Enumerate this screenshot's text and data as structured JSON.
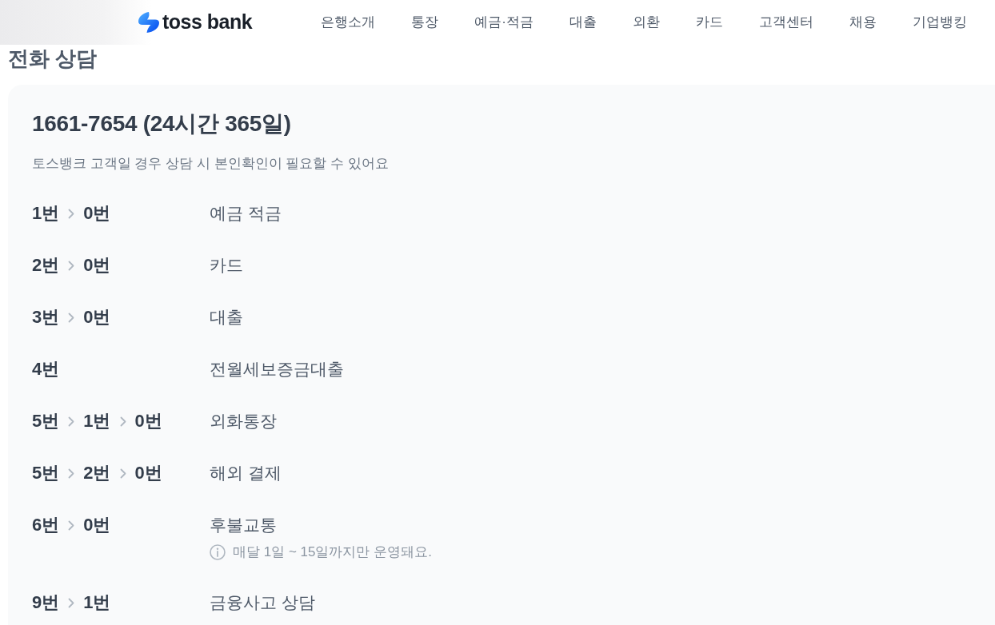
{
  "header": {
    "logo_text": "toss bank",
    "nav_items": [
      "은행소개",
      "통장",
      "예금·적금",
      "대출",
      "외환",
      "카드",
      "고객센터",
      "채용",
      "기업뱅킹"
    ]
  },
  "page_title": "전화 상담",
  "phone_card": {
    "title": "1661-7654 (24시간 365일)",
    "subtitle": "토스뱅크 고객일 경우 상담 시 본인확인이 필요할 수 있어요",
    "menu": [
      {
        "keys": [
          "1번",
          "0번"
        ],
        "label": "예금 적금"
      },
      {
        "keys": [
          "2번",
          "0번"
        ],
        "label": "카드"
      },
      {
        "keys": [
          "3번",
          "0번"
        ],
        "label": "대출"
      },
      {
        "keys": [
          "4번"
        ],
        "label": "전월세보증금대출"
      },
      {
        "keys": [
          "5번",
          "1번",
          "0번"
        ],
        "label": "외화통장"
      },
      {
        "keys": [
          "5번",
          "2번",
          "0번"
        ],
        "label": "해외 결제"
      },
      {
        "keys": [
          "6번",
          "0번"
        ],
        "label": "후불교통",
        "note": "매달 1일 ~ 15일까지만 운영돼요."
      },
      {
        "keys": [
          "9번",
          "1번"
        ],
        "label": "금융사고 상담"
      }
    ]
  }
}
